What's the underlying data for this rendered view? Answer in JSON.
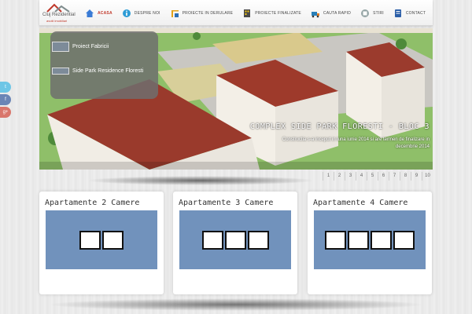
{
  "logo": {
    "text": "Cluj Rezidential",
    "subtext": "avutii imobiliari"
  },
  "nav": {
    "items": [
      {
        "label": "ACASA",
        "icon": "home-icon",
        "active": true
      },
      {
        "label": "DESPRE NOI",
        "icon": "info-icon",
        "active": false
      },
      {
        "label": "PROIECTE IN DERULARE",
        "icon": "crane-icon",
        "active": false
      },
      {
        "label": "PROIECTE FINALIZATE",
        "icon": "building-icon",
        "active": false
      },
      {
        "label": "CAUTA RAPID",
        "icon": "search-truck-icon",
        "active": false
      },
      {
        "label": "STIRI",
        "icon": "news-icon",
        "active": false
      },
      {
        "label": "CONTACT",
        "icon": "contact-icon",
        "active": false
      }
    ]
  },
  "social": [
    "t",
    "f",
    "g+"
  ],
  "slider": {
    "menu": [
      {
        "label": "Proiect Fabricii"
      },
      {
        "label": "Side Park Residence Floresti"
      }
    ],
    "caption_title": "COMPLEX SIDE PARK FLORESTI - BLOC 3",
    "caption_text": "Constructia s-a inceput in luna iunie 2014 si are termen de finalizare in decembrie 2014",
    "pages": [
      "1",
      "2",
      "3",
      "4",
      "5",
      "6",
      "7",
      "8",
      "9",
      "10"
    ]
  },
  "cards": [
    {
      "title": "Apartamente 2 Camere",
      "boxes": 2
    },
    {
      "title": "Apartamente 3 Camere",
      "boxes": 3
    },
    {
      "title": "Apartamente 4 Camere",
      "boxes": 4
    }
  ],
  "colors": {
    "accent": "#c0392b",
    "card_image": "#7192bc"
  }
}
